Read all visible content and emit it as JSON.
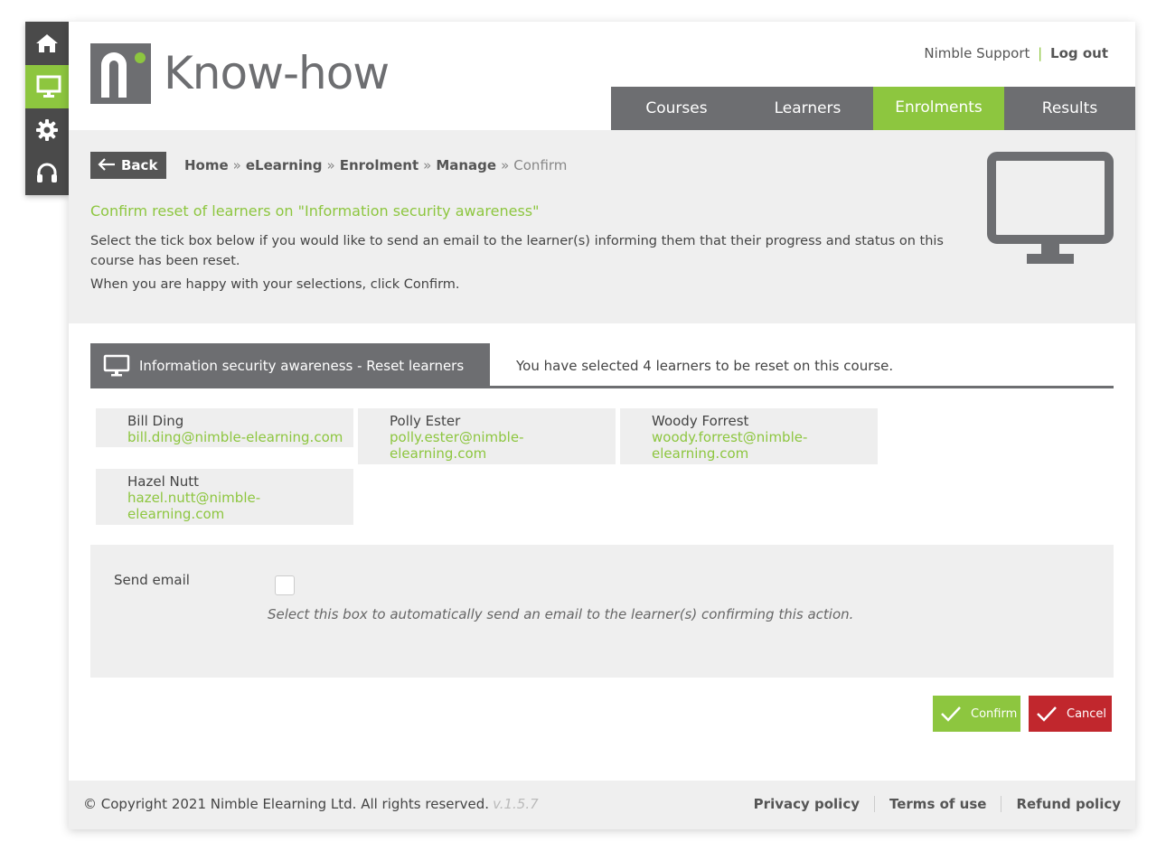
{
  "rail": {
    "items": [
      {
        "name": "home",
        "icon": "home-icon"
      },
      {
        "name": "elearning",
        "icon": "monitor-icon",
        "active": true
      },
      {
        "name": "settings",
        "icon": "gear-icon"
      },
      {
        "name": "support",
        "icon": "headset-icon"
      }
    ]
  },
  "header": {
    "logo_text": "Know-how",
    "user_name": "Nimble Support",
    "separator": "|",
    "logout_label": "Log out"
  },
  "nav": {
    "tabs": [
      {
        "label": "Courses"
      },
      {
        "label": "Learners"
      },
      {
        "label": "Enrolments",
        "active": true
      },
      {
        "label": "Results"
      }
    ]
  },
  "intro": {
    "back_label": "Back",
    "breadcrumb": {
      "home": "Home",
      "elearning": "eLearning",
      "enrolment": "Enrolment",
      "manage": "Manage",
      "current": "Confirm",
      "sep": "»"
    },
    "title": "Confirm reset of learners on \"Information security awareness\"",
    "paragraph1": "Select the tick box below if you would like to send an email to the learner(s) informing them that their progress and status on this course has been reset.",
    "paragraph2": "When you are happy with your selections, click Confirm."
  },
  "course": {
    "tab_label": "Information security awareness - Reset learners",
    "selected_info": "You have selected 4 learners to be reset on this course."
  },
  "learners": [
    {
      "name": "Bill Ding",
      "email": "bill.ding@nimble-elearning.com"
    },
    {
      "name": "Polly Ester",
      "email": "polly.ester@nimble-elearning.com"
    },
    {
      "name": "Woody Forrest",
      "email": "woody.forrest@nimble-elearning.com"
    },
    {
      "name": "Hazel Nutt",
      "email": "hazel.nutt@nimble-elearning.com"
    }
  ],
  "email_option": {
    "label": "Send email",
    "checked": false,
    "help": "Select this box to automatically send an email to the learner(s) confirming this action."
  },
  "actions": {
    "confirm_label": "Confirm",
    "cancel_label": "Cancel"
  },
  "footer": {
    "copyright": "© Copyright 2021 Nimble Elearning Ltd. All rights reserved.",
    "version": "v.1.5.7",
    "links": [
      "Privacy policy",
      "Terms of use",
      "Refund policy"
    ]
  },
  "colors": {
    "brand_green": "#8dc63f",
    "brand_grey": "#6d6e71",
    "cancel_red": "#c1272d",
    "panel_grey": "#efefef"
  }
}
